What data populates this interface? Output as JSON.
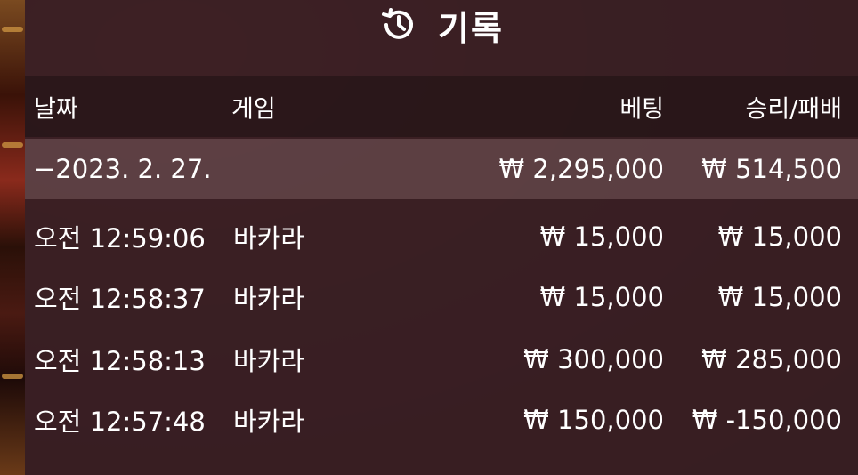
{
  "header": {
    "icon": "history-icon",
    "title": "기록"
  },
  "columns": {
    "date": "날짜",
    "game": "게임",
    "bet": "베팅",
    "result": "승리/패배"
  },
  "summary": {
    "date": "−2023. 2. 27.",
    "bet": "₩ 2,295,000",
    "result": "₩ 514,500"
  },
  "rows": [
    {
      "time": "오전 12:59:06",
      "game": "바카라",
      "bet": "₩ 15,000",
      "result": "₩ 15,000"
    },
    {
      "time": "오전 12:58:37",
      "game": "바카라",
      "bet": "₩ 15,000",
      "result": "₩ 15,000"
    },
    {
      "time": "오전 12:58:13",
      "game": "바카라",
      "bet": "₩ 300,000",
      "result": "₩ 285,000"
    },
    {
      "time": "오전 12:57:48",
      "game": "바카라",
      "bet": "₩ 150,000",
      "result": "₩ -150,000"
    }
  ]
}
